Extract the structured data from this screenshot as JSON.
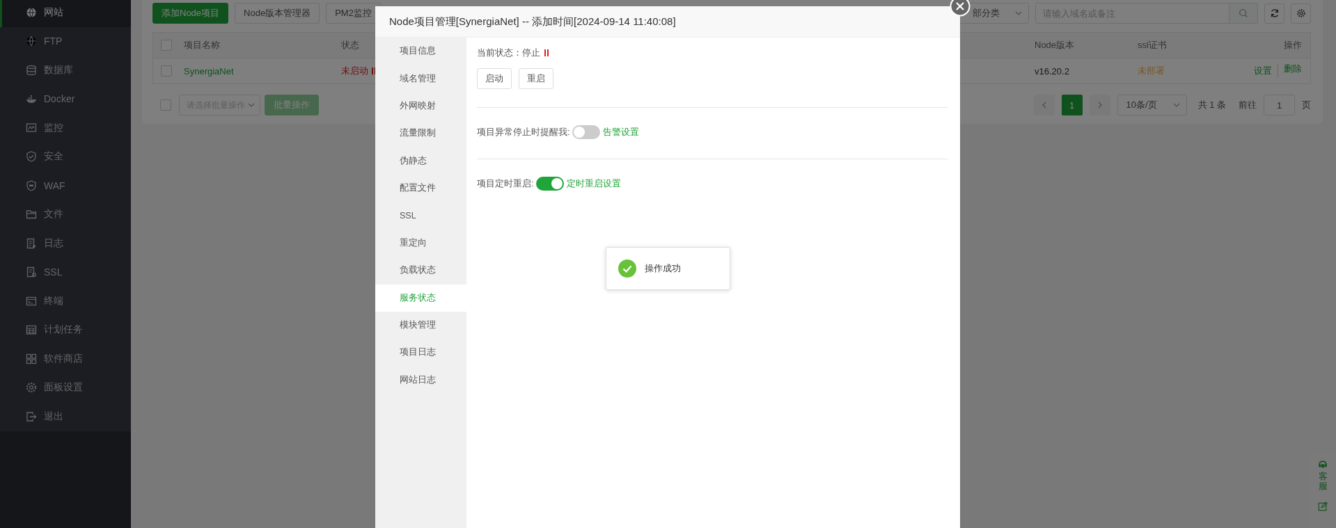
{
  "sidebar": {
    "items": [
      {
        "label": "网站",
        "selected": true
      },
      {
        "label": "FTP",
        "selected": false
      },
      {
        "label": "数据库",
        "selected": false
      },
      {
        "label": "Docker",
        "selected": false
      },
      {
        "label": "监控",
        "selected": false
      },
      {
        "label": "安全",
        "selected": false
      },
      {
        "label": "WAF",
        "selected": false
      },
      {
        "label": "文件",
        "selected": false
      },
      {
        "label": "日志",
        "selected": false
      },
      {
        "label": "SSL",
        "selected": false
      },
      {
        "label": "终端",
        "selected": false
      },
      {
        "label": "计划任务",
        "selected": false
      },
      {
        "label": "软件商店",
        "selected": false
      },
      {
        "label": "面板设置",
        "selected": false
      },
      {
        "label": "退出",
        "selected": false
      }
    ]
  },
  "toolbar": {
    "buttons": [
      {
        "label": "添加Node项目",
        "kind": "primary"
      },
      {
        "label": "Node版本管理器",
        "kind": "default"
      },
      {
        "label": "PM2监控",
        "kind": "default"
      }
    ],
    "category": {
      "value": "部分类"
    },
    "search": {
      "placeholder": "请输入域名或备注"
    }
  },
  "table": {
    "select_all": {
      "checked": false
    },
    "columns": [
      "项目名称",
      "状态",
      "Node版本",
      "ssl证书",
      "操作"
    ],
    "rows": [
      {
        "checked": false,
        "name": "SynergiaNet",
        "status": "未启动",
        "running": false,
        "node_version": "v16.20.2",
        "ssl": "未部署",
        "actions": [
          "设置",
          "删除"
        ]
      }
    ]
  },
  "batch": {
    "checked": false,
    "placeholder": "请选择批量操作",
    "button": {
      "label": "批量操作",
      "disabled": true
    }
  },
  "pagination": {
    "pages": [
      {
        "label": "1",
        "selected": true
      }
    ],
    "page_size": "10条/页",
    "total": "共 1 条",
    "goto_label": "前往",
    "goto_value": "1",
    "page_unit": "页"
  },
  "modal": {
    "title": "Node项目管理[SynergiaNet] -- 添加时间[2024-09-14 11:40:08]",
    "menu": [
      {
        "label": "项目信息",
        "selected": false
      },
      {
        "label": "域名管理",
        "selected": false
      },
      {
        "label": "外网映射",
        "selected": false
      },
      {
        "label": "流量限制",
        "selected": false
      },
      {
        "label": "伪静态",
        "selected": false
      },
      {
        "label": "配置文件",
        "selected": false
      },
      {
        "label": "SSL",
        "selected": false
      },
      {
        "label": "重定向",
        "selected": false
      },
      {
        "label": "负载状态",
        "selected": false
      },
      {
        "label": "服务状态",
        "selected": true
      },
      {
        "label": "模块管理",
        "selected": false
      },
      {
        "label": "项目日志",
        "selected": false
      },
      {
        "label": "网站日志",
        "selected": false
      }
    ],
    "status": {
      "label": "当前状态：停止",
      "running": false
    },
    "buttons": [
      "启动",
      "重启"
    ],
    "switches": [
      {
        "label": "项目异常停止时提醒我:",
        "on": false,
        "link": "告警设置"
      },
      {
        "label": "项目定时重启:",
        "on": true,
        "link": "定时重启设置"
      }
    ]
  },
  "toast": {
    "message": "操作成功"
  },
  "help_widget": {
    "label": "客服"
  }
}
